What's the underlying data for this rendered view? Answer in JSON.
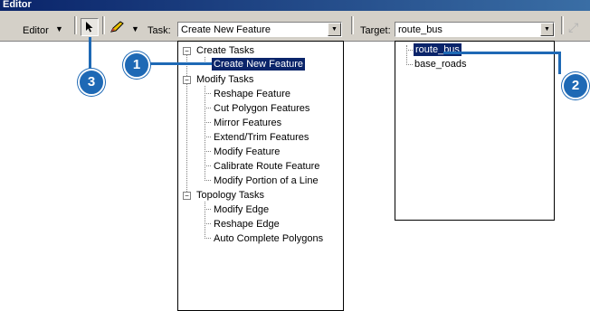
{
  "window": {
    "title": "Editor"
  },
  "toolbar": {
    "editor_menu": "Editor",
    "task_label": "Task:",
    "task_value": "Create New Feature",
    "target_label": "Target:",
    "target_value": "route_bus"
  },
  "task_tree": {
    "groups": [
      {
        "label": "Create Tasks",
        "items": [
          "Create New Feature"
        ]
      },
      {
        "label": "Modify Tasks",
        "items": [
          "Reshape Feature",
          "Cut Polygon Features",
          "Mirror Features",
          "Extend/Trim Features",
          "Modify Feature",
          "Calibrate Route Feature",
          "Modify Portion of a Line"
        ]
      },
      {
        "label": "Topology Tasks",
        "items": [
          "Modify Edge",
          "Reshape Edge",
          "Auto Complete Polygons"
        ]
      }
    ],
    "selected": "Create New Feature"
  },
  "target_list": {
    "items": [
      "route_bus",
      "base_roads"
    ],
    "selected": "route_bus"
  },
  "callouts": {
    "c1": "1",
    "c2": "2",
    "c3": "3"
  },
  "colors": {
    "callout": "#1e69b5",
    "selection": "#0a246a",
    "toolbar": "#d4d0c8"
  }
}
